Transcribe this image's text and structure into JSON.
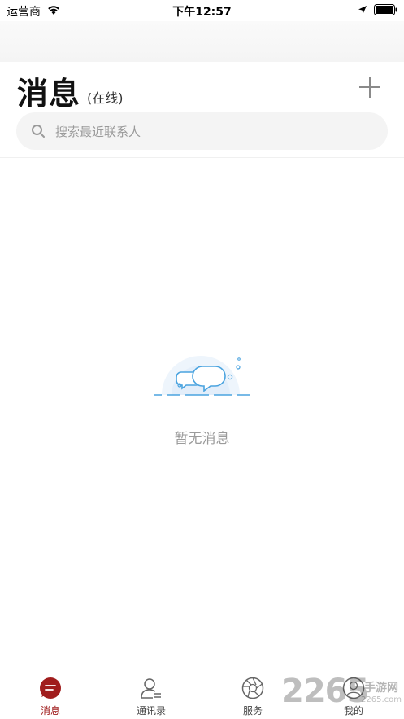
{
  "status_bar": {
    "carrier": "运营商",
    "time": "下午12:57"
  },
  "header": {
    "title": "消息",
    "status": "(在线)",
    "add_icon": "plus-icon"
  },
  "search": {
    "placeholder": "搜索最近联系人"
  },
  "empty_state": {
    "text": "暂无消息",
    "accent_color": "#4aa3df"
  },
  "tab_bar": {
    "active_color": "#a01d1d",
    "tabs": [
      {
        "label": "消息",
        "icon": "message-icon",
        "active": true
      },
      {
        "label": "通讯录",
        "icon": "contacts-icon",
        "active": false
      },
      {
        "label": "服务",
        "icon": "service-aperture-icon",
        "active": false
      },
      {
        "label": "我的",
        "icon": "profile-icon",
        "active": false
      }
    ]
  },
  "watermark": {
    "digits": "2265",
    "text": "手游网",
    "domain": "2265.com"
  }
}
